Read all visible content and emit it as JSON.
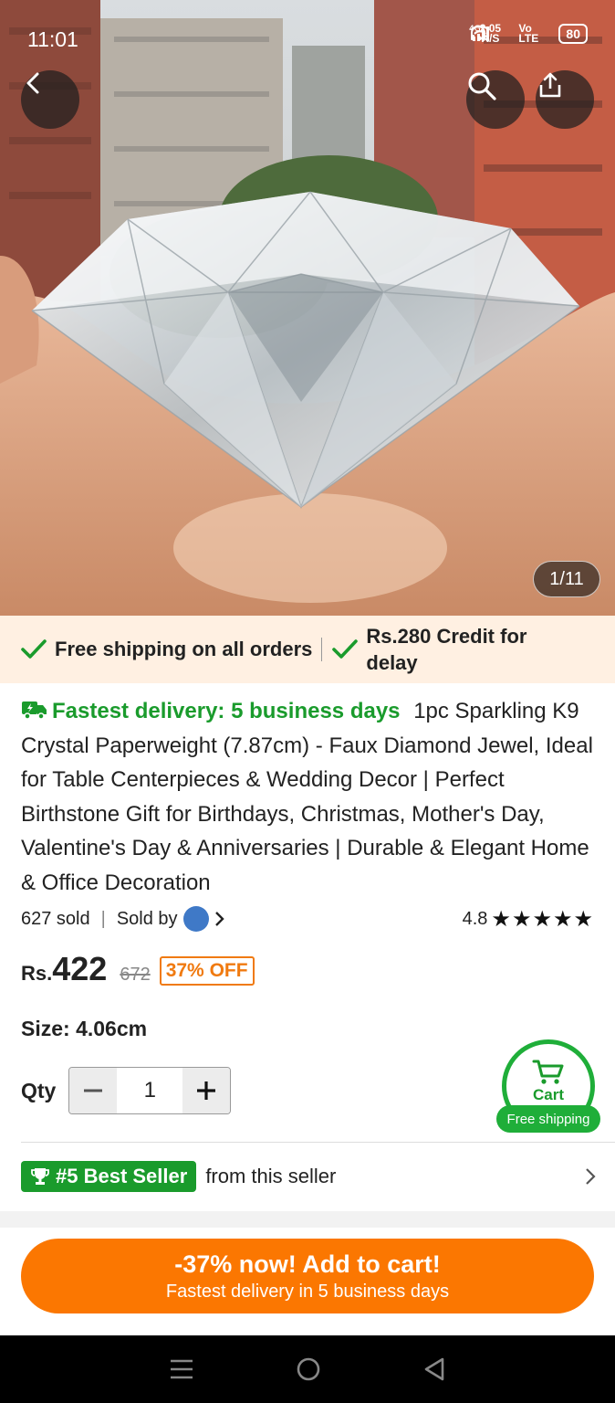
{
  "status": {
    "time": "11:01",
    "net_speed": "2.05 K/S",
    "net_labels": [
      "Vo LTE",
      "4G",
      "4G"
    ],
    "battery": "80"
  },
  "hero": {
    "image_counter": "1/11"
  },
  "shipping": {
    "free_shipping": "Free shipping on all orders",
    "credit": "Rs.280 Credit for delay"
  },
  "product": {
    "fastest_delivery": "Fastest delivery: 5 business days",
    "title": "1pc Sparkling K9 Crystal Paperweight (7.87cm) - Faux Diamond Jewel, Ideal for Table Centerpieces & Wedding Decor | Perfect Birthstone Gift for Birthdays, Christmas, Mother's Day, Valentine's Day & Anniversaries | Durable & Elegant Home & Office Decoration",
    "sold": "627 sold",
    "sold_by": "Sold by",
    "rating": "4.8",
    "stars": 5
  },
  "price": {
    "currency": "Rs.",
    "current": "422",
    "original": "672",
    "discount": "37% OFF"
  },
  "size": {
    "label": "Size: 4.06cm"
  },
  "qty": {
    "label": "Qty",
    "value": "1"
  },
  "cart": {
    "label": "Cart",
    "free_shipping": "Free shipping"
  },
  "best_seller": {
    "badge": "#5 Best Seller",
    "text": "from this seller"
  },
  "cta": {
    "main": "-37% now! Add to cart!",
    "sub": "Fastest delivery in 5 business days"
  },
  "colors": {
    "accent": "#fb7701",
    "green": "#1a9b2c",
    "strip": "#fff0e2"
  }
}
